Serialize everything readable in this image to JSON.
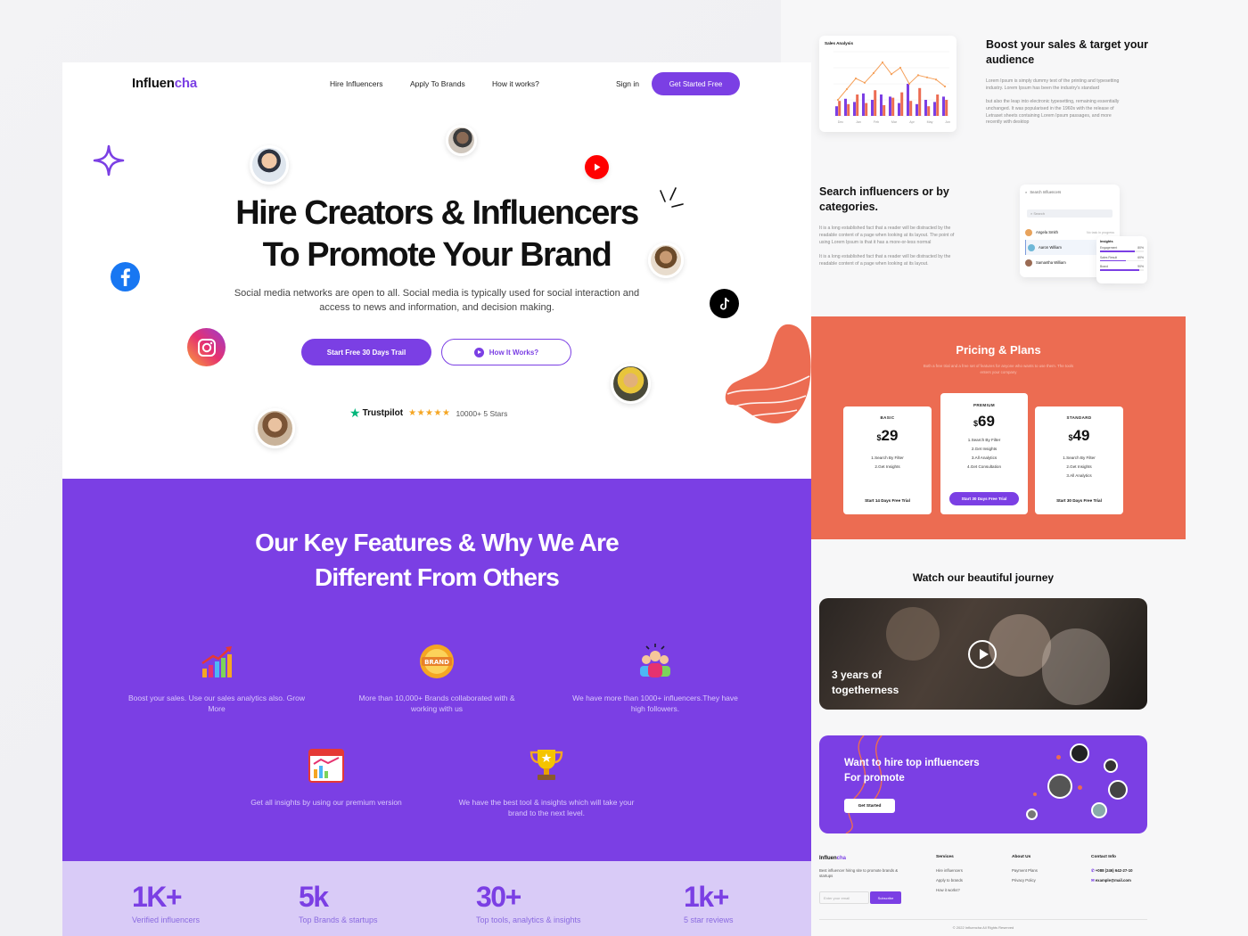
{
  "brand": {
    "name_part1": "Influen",
    "name_part2": "cha",
    "accent": "#7b3fe4",
    "orange": "#ec6c52"
  },
  "nav": {
    "links": [
      "Hire Influencers",
      "Apply To Brands",
      "How it works?"
    ],
    "signin": "Sign in",
    "cta": "Get Started Free"
  },
  "hero": {
    "title_line1": "Hire Creators & Influencers",
    "title_line2": "To Promote Your Brand",
    "subtitle": "Social media networks are open to all. Social media is typically used for social interaction and access to news and information, and decision making.",
    "btn_primary": "Start Free 30 Days Trail",
    "btn_secondary": "How It Works?",
    "trust_brand": "Trustpilot",
    "trust_stars": "★★★★★",
    "trust_text": "10000+  5 Stars"
  },
  "features": {
    "title_line1": "Our Key Features & Why We Are",
    "title_line2": "Different From Others",
    "items": [
      {
        "icon": "growth-chart-icon",
        "text": "Boost your sales. Use our sales analytics also. Grow More"
      },
      {
        "icon": "brand-badge-icon",
        "text": "More than 10,000+ Brands collaborated with & working with us"
      },
      {
        "icon": "team-group-icon",
        "text": "We have more than 1000+ influencers.They have high followers."
      },
      {
        "icon": "insights-dashboard-icon",
        "text": "Get all insights by using our premium version"
      },
      {
        "icon": "trophy-icon",
        "text": "We have the best tool & insights which will take your brand to the next level."
      }
    ]
  },
  "stats": [
    {
      "num": "1K+",
      "label": "Verified influencers"
    },
    {
      "num": "5k",
      "label": "Top Brands & startups"
    },
    {
      "num": "30+",
      "label": "Top tools, analytics & insights"
    },
    {
      "num": "1k+",
      "label": "5 star reviews"
    }
  ],
  "sales": {
    "card_title": "Sales Analysis",
    "heading": "Boost your sales & target your audience",
    "para1": "Lorem Ipsum is simply dummy text of the printing and typesetting industry. Lorem Ipsum has been the industry's standard",
    "para2": "but also the leap into electronic typesetting, remaining essentially unchanged. It was popularised in the 1960s with the release of Letraset sheets containing Lorem Ipsum passages, and more recently with desktop",
    "chart_data": {
      "type": "bar",
      "title": "Sales Analysis",
      "categories": [
        "Dec",
        "Jan",
        "Feb",
        "Mar",
        "Apr",
        "May",
        "Jun"
      ],
      "ylim": [
        0,
        120
      ],
      "line": [
        30,
        50,
        70,
        62,
        80,
        100,
        78,
        90,
        60,
        76,
        72,
        68,
        55
      ],
      "series": [
        {
          "values": [
            18,
            32,
            26,
            42,
            30,
            40,
            36,
            24,
            60,
            22,
            30,
            26,
            36
          ]
        },
        {
          "values": [
            28,
            22,
            40,
            24,
            48,
            20,
            34,
            44,
            28,
            52,
            18,
            40,
            30
          ]
        }
      ]
    }
  },
  "search": {
    "heading": "Search influencers or by categories.",
    "para1": "It is a long established fact that a reader will be distracted by the readable content of a page when looking at its layout. The point of using Lorem Ipsum is that it has a more-or-less normal",
    "para2": "It is a long established fact that a reader will be distracted by the readable content of a page when looking at its layout.",
    "panel_title": "Search Influencers",
    "search_placeholder": "Search",
    "people": [
      {
        "name": "Angela Smith",
        "meta": "No task in progress"
      },
      {
        "name": "Aaron William",
        "meta": "120 tasks"
      },
      {
        "name": "Samantha William",
        "meta": "120 tasks"
      }
    ],
    "insights_title": "Insights",
    "insights": [
      {
        "label": "Engagement",
        "pct": "80%",
        "value": 0.8
      },
      {
        "label": "Sales Result",
        "pct": "60%",
        "value": 0.6
      },
      {
        "label": "Brand",
        "pct": "90%",
        "value": 0.9
      }
    ]
  },
  "pricing": {
    "title": "Pricing & Plans",
    "subtitle": "Both a free trial and a free set of features for anyone who wants to use them. The tools enters your company",
    "plans": [
      {
        "name": "BASIC",
        "currency": "$",
        "price": "29",
        "features": [
          "1.Search By Filter",
          "2.Get Insights"
        ],
        "cta": "Start 14 Days Free Trial"
      },
      {
        "name": "PREMIUM",
        "currency": "$",
        "price": "69",
        "features": [
          "1.Search By Filter",
          "2.Get Insights",
          "3.All Analytics",
          "4.Get Consultation"
        ],
        "cta": "Start 30 Days Free Trial"
      },
      {
        "name": "STANDARD",
        "currency": "$",
        "price": "49",
        "features": [
          "1.Search By Filter",
          "2.Get Insights",
          "3.All Analytics"
        ],
        "cta": "Start 30 Days Free Trial"
      }
    ]
  },
  "journey": {
    "heading": "Watch our beautiful journey",
    "caption_line1": "3 years of",
    "caption_line2": "togetherness"
  },
  "cta": {
    "line1": "Want to hire top influencers",
    "line2": "For promote",
    "button": "Get Started"
  },
  "footer": {
    "tagline": "Best influencer hiring site to promote brands & startups",
    "email_placeholder": "Enter your email",
    "subscribe": "Subscribe",
    "services_title": "Services",
    "services": [
      "Hire influencers",
      "Apply to brands",
      "How it works?"
    ],
    "about_title": "About Us",
    "about": [
      "Payment Plans",
      "Privacy Policy"
    ],
    "contact_title": "Contact Info",
    "phone": "+088 (246) 642-27-10",
    "email": "example@mail.com",
    "copyright": "© 2022 Influencha All Rights Reserved"
  }
}
